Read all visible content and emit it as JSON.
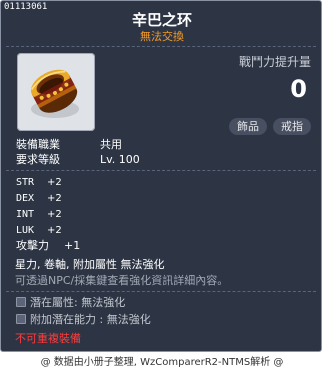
{
  "item": {
    "id": "01113061",
    "name": "辛巴之环",
    "trade_status": "無法交換",
    "power_label": "戰鬥力提升量",
    "power_value": "0",
    "tags": [
      "飾品",
      "戒指"
    ],
    "class_label": "裝備職業",
    "class_value": "共用",
    "level_label": "要求等級",
    "level_value": "Lv. 100",
    "stats": [
      {
        "name": "STR",
        "value": "+2"
      },
      {
        "name": "DEX",
        "value": "+2"
      },
      {
        "name": "INT",
        "value": "+2"
      },
      {
        "name": "LUK",
        "value": "+2"
      }
    ],
    "attack_label": "攻擊力",
    "attack_value": "+1",
    "enhance_text": "星力, 卷軸, 附加屬性 無法強化",
    "info_text": "可透過NPC/採集鍵查看強化資訊詳細內容。",
    "potential": {
      "label": "潛在屬性",
      "value": "無法強化"
    },
    "bonus_potential": {
      "label": "附加潛在能力",
      "value": "無法強化"
    },
    "unique_text": "不可重複裝備",
    "icon": "ring-icon"
  },
  "footer": "@ 数据由小册子整理, WzComparerR2-NTMS解析 @",
  "colors": {
    "background": "#2d3545",
    "orange": "#f39a28",
    "red": "#ff3b3b",
    "grey_text": "#a3a9b5"
  }
}
